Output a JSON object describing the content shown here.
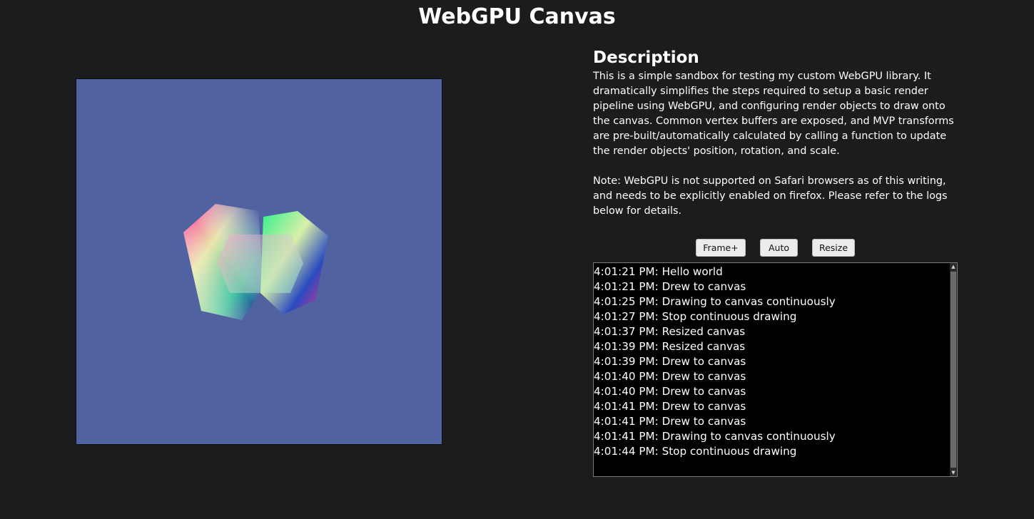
{
  "page": {
    "title": "WebGPU Canvas"
  },
  "canvas": {
    "background_color": "#5063a0"
  },
  "description": {
    "heading": "Description",
    "text": "This is a simple sandbox for testing my custom WebGPU library. It dramatically simplifies the steps required to setup a basic render pipeline using WebGPU, and configuring render objects to draw onto the canvas. Common vertex buffers are exposed, and MVP transforms are pre-built/automatically calculated by calling a function to update the render objects' position, rotation, and scale.",
    "note": "Note: WebGPU is not supported on Safari browsers as of this writing, and needs to be explicitly enabled on firefox. Please refer to the logs below for details."
  },
  "controls": {
    "frame_label": "Frame+",
    "auto_label": "Auto",
    "resize_label": "Resize"
  },
  "logs": [
    "4:01:21 PM: Hello world",
    "4:01:21 PM: Drew to canvas",
    "4:01:25 PM: Drawing to canvas continuously",
    "4:01:27 PM: Stop continuous drawing",
    "4:01:37 PM: Resized canvas",
    "4:01:39 PM: Resized canvas",
    "4:01:39 PM: Drew to canvas",
    "4:01:40 PM: Drew to canvas",
    "4:01:40 PM: Drew to canvas",
    "4:01:41 PM: Drew to canvas",
    "4:01:41 PM: Drew to canvas",
    "4:01:41 PM: Drawing to canvas continuously",
    "4:01:44 PM: Stop continuous drawing"
  ],
  "icons": {
    "scroll_up": "scroll-up-arrow-icon",
    "scroll_down": "scroll-down-arrow-icon"
  }
}
